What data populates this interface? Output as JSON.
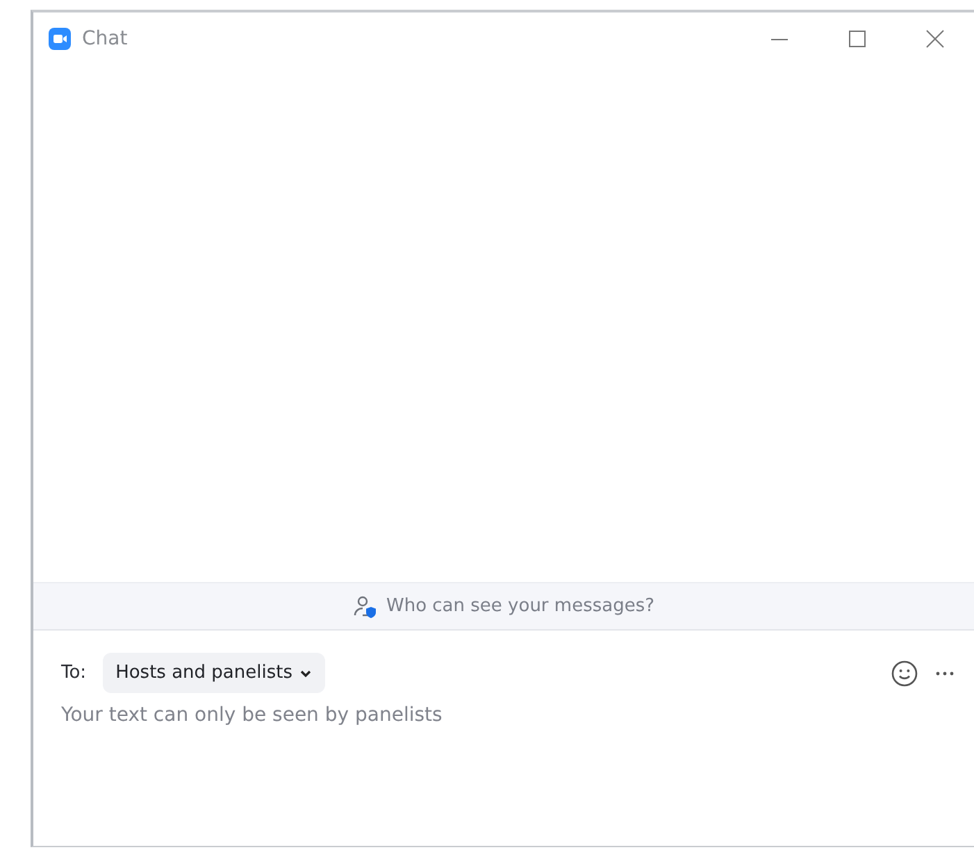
{
  "window": {
    "title": "Chat"
  },
  "notice": {
    "text": "Who can see your messages?"
  },
  "composer": {
    "to_label": "To:",
    "recipient": "Hosts and panelists",
    "placeholder": "Your text can only be seen by panelists"
  }
}
